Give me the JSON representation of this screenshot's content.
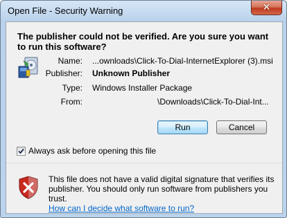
{
  "window": {
    "title": "Open File - Security Warning",
    "close_glyph": "✕"
  },
  "dialog": {
    "heading": "The publisher could not be verified.  Are you sure you want to run this software?",
    "fields": {
      "name_label": "Name:",
      "name_value": "...ownloads\\Click-To-Dial-InternetExplorer (3).msi",
      "publisher_label": "Publisher:",
      "publisher_value": "Unknown Publisher",
      "type_label": "Type:",
      "type_value": "Windows Installer Package",
      "from_label": "From:",
      "from_value": "\\Downloads\\Click-To-Dial-Int..."
    },
    "buttons": {
      "run": "Run",
      "cancel": "Cancel"
    },
    "checkbox": {
      "label": "Always ask before opening this file",
      "checked": true
    },
    "warning": {
      "text": "This file does not have a valid digital signature that verifies its publisher.  You should only run software from publishers you trust.",
      "link": "How can I decide what software to run?"
    }
  },
  "icons": {
    "installer": "windows-installer-icon",
    "shield": "shield-error-icon",
    "checkmark": "checkmark-icon"
  }
}
